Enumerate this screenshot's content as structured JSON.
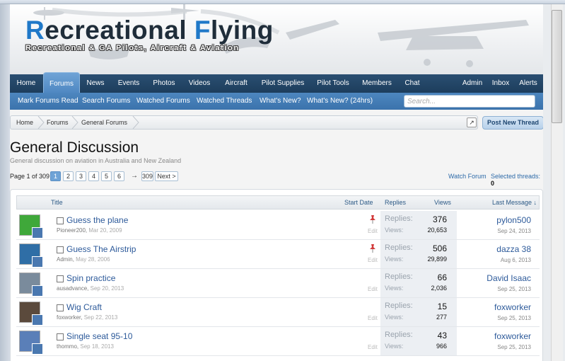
{
  "site": {
    "title_prefix_r": "R",
    "title_mid": "ecreational ",
    "title_f": "F",
    "title_end": "lying",
    "subtitle": "Recreational & GA Pilots, Aircraft & Aviation"
  },
  "nav": {
    "items": [
      "Home",
      "Forums",
      "News",
      "Events",
      "Photos",
      "Videos",
      "Aircraft",
      "Pilot Supplies",
      "Pilot Tools",
      "Members",
      "Chat"
    ],
    "right_items": [
      "Admin",
      "Inbox",
      "Alerts"
    ],
    "active": "Forums"
  },
  "subnav": {
    "items": [
      "Mark Forums Read",
      "Search Forums",
      "Watched Forums",
      "Watched Threads",
      "What's New?",
      "What's New? (24hrs)"
    ],
    "search_placeholder": "Search..."
  },
  "breadcrumb": [
    "Home",
    "Forums",
    "General Forums"
  ],
  "post_new_thread": "Post New Thread",
  "forum": {
    "title": "General Discussion",
    "description": "General discussion on aviation in Australia and New Zealand"
  },
  "pagination": {
    "label": "Page 1 of 309",
    "pages": [
      "1",
      "2",
      "3",
      "4",
      "5",
      "6"
    ],
    "arrow": "→",
    "last": "309",
    "next": "Next >"
  },
  "actions": {
    "watch_forum": "Watch Forum",
    "selected_threads_label": "Selected threads:",
    "selected_threads_count": "0"
  },
  "columns": {
    "title": "Title",
    "start_date": "Start Date",
    "replies": "Replies",
    "views": "Views",
    "last_message": "Last Message ↓"
  },
  "labels": {
    "replies": "Replies:",
    "views": "Views:",
    "edit": "Edit"
  },
  "threads": [
    {
      "title": "Guess the plane",
      "author": "Pioneer200",
      "date": "Mar 20, 2009",
      "sticky": true,
      "replies": "376",
      "views": "20,653",
      "last_user": "pylon500",
      "last_date": "Sep 24, 2013",
      "avatar_color": "#3fa83a"
    },
    {
      "title": "Guess The Airstrip",
      "author": "Admin",
      "date": "May 28, 2006",
      "sticky": true,
      "replies": "506",
      "views": "29,899",
      "last_user": "dazza 38",
      "last_date": "Aug 6, 2013",
      "avatar_color": "#2f6ea6"
    },
    {
      "title": "Spin practice",
      "author": "ausadvance",
      "date": "Sep 20, 2013",
      "sticky": false,
      "replies": "66",
      "views": "2,036",
      "last_user": "David Isaac",
      "last_date": "Sep 25, 2013",
      "avatar_color": "#7a8b9c"
    },
    {
      "title": "Wig Craft",
      "author": "foxworker",
      "date": "Sep 22, 2013",
      "sticky": false,
      "replies": "15",
      "views": "277",
      "last_user": "foxworker",
      "last_date": "Sep 25, 2013",
      "avatar_color": "#5b4a3c"
    },
    {
      "title": "Single seat 95-10",
      "author": "thommo",
      "date": "Sep 18, 2013",
      "sticky": false,
      "replies": "43",
      "views": "966",
      "last_user": "foxworker",
      "last_date": "Sep 25, 2013",
      "avatar_color": "#5a7fb8"
    }
  ]
}
